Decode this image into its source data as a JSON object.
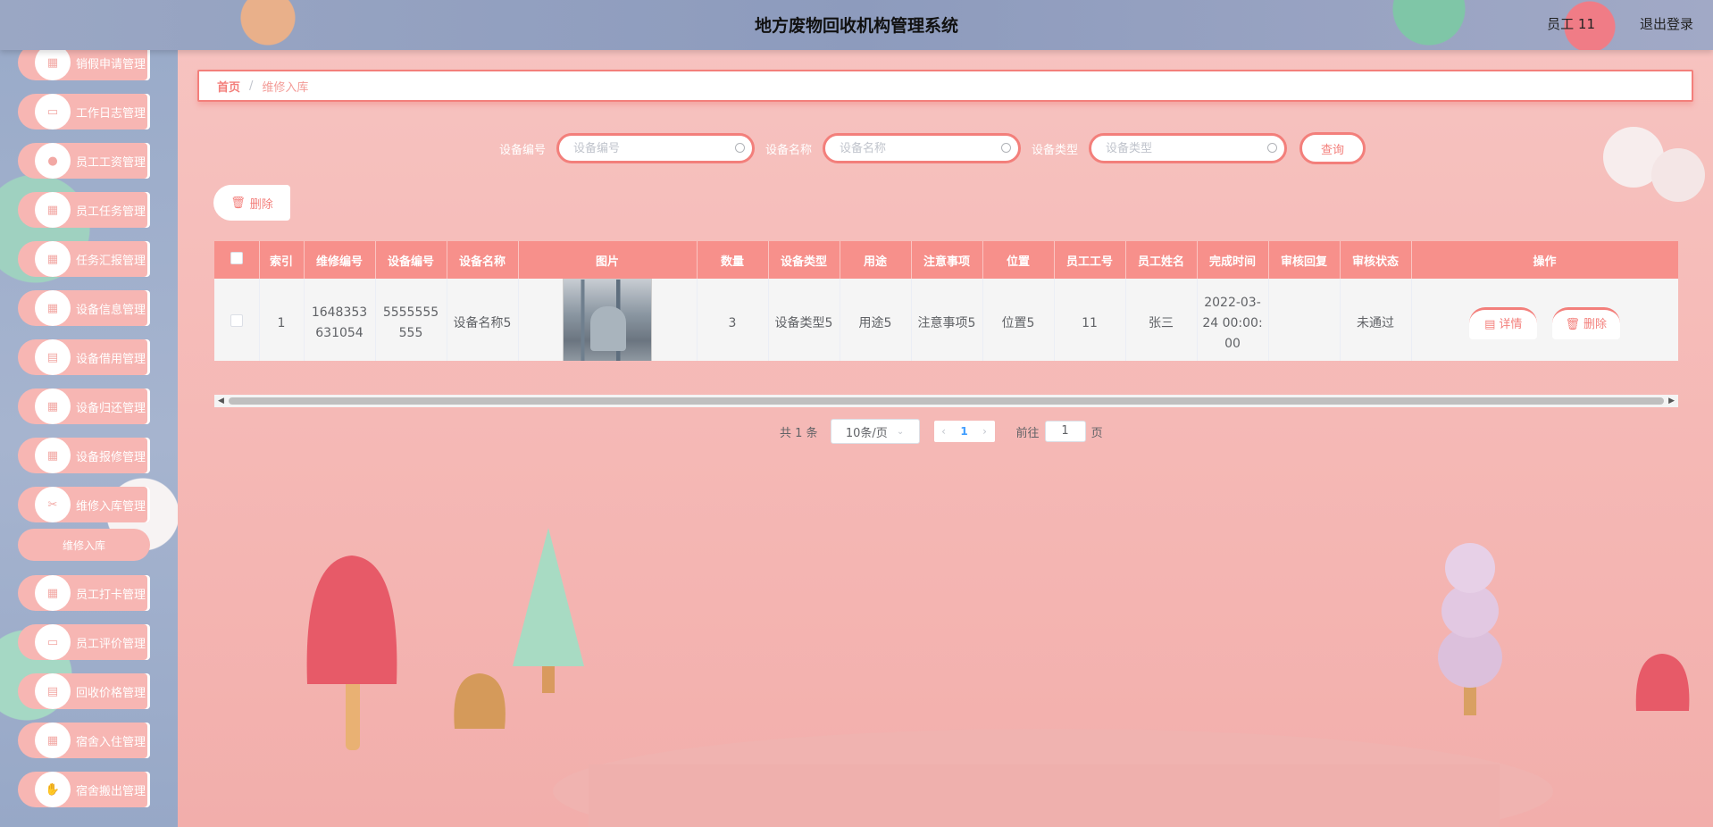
{
  "header": {
    "title": "地方废物回收机构管理系统",
    "user": "员工 11",
    "logout": "退出登录"
  },
  "sidebar": {
    "items": [
      {
        "label": "销假申请管理",
        "icon": "grid-icon",
        "glyph": "▦"
      },
      {
        "label": "工作日志管理",
        "icon": "monitor-icon",
        "glyph": "▭"
      },
      {
        "label": "员工工资管理",
        "icon": "user-icon",
        "glyph": "●"
      },
      {
        "label": "员工任务管理",
        "icon": "grid-icon",
        "glyph": "▦"
      },
      {
        "label": "任务汇报管理",
        "icon": "grid-icon",
        "glyph": "▦"
      },
      {
        "label": "设备信息管理",
        "icon": "grid-icon",
        "glyph": "▦"
      },
      {
        "label": "设备借用管理",
        "icon": "clipboard-icon",
        "glyph": "▤"
      },
      {
        "label": "设备归还管理",
        "icon": "grid-icon",
        "glyph": "▦"
      },
      {
        "label": "设备报修管理",
        "icon": "grid-icon",
        "glyph": "▦"
      },
      {
        "label": "维修入库管理",
        "icon": "ticket-icon",
        "glyph": "✂"
      }
    ],
    "submenu": "维修入库",
    "items_after": [
      {
        "label": "员工打卡管理",
        "icon": "grid-icon",
        "glyph": "▦"
      },
      {
        "label": "员工评价管理",
        "icon": "message-icon",
        "glyph": "▭"
      },
      {
        "label": "回收价格管理",
        "icon": "document-icon",
        "glyph": "▤"
      },
      {
        "label": "宿舍入住管理",
        "icon": "grid-icon",
        "glyph": "▦"
      },
      {
        "label": "宿舍搬出管理",
        "icon": "thumb-icon",
        "glyph": "✋"
      }
    ]
  },
  "breadcrumb": {
    "home": "首页",
    "separator": "/",
    "current": "维修入库"
  },
  "search": {
    "device_no_label": "设备编号",
    "device_no_placeholder": "设备编号",
    "device_name_label": "设备名称",
    "device_name_placeholder": "设备名称",
    "device_type_label": "设备类型",
    "device_type_placeholder": "设备类型",
    "query_button": "查询"
  },
  "toolbar": {
    "delete_button": "删除"
  },
  "table": {
    "columns": [
      "索引",
      "维修编号",
      "设备编号",
      "设备名称",
      "图片",
      "数量",
      "设备类型",
      "用途",
      "注意事项",
      "位置",
      "员工工号",
      "员工姓名",
      "完成时间",
      "审核回复",
      "审核状态",
      "操作"
    ],
    "rows": [
      {
        "index": "1",
        "repair_no": "1648353631054",
        "device_no": "5555555555",
        "device_name": "设备名称5",
        "quantity": "3",
        "device_type": "设备类型5",
        "purpose": "用途5",
        "notes": "注意事项5",
        "location": "位置5",
        "staff_no": "11",
        "staff_name": "张三",
        "finish_time": "2022-03-24 00:00:00",
        "review_reply": "",
        "review_status": "未通过",
        "detail_button": "详情",
        "delete_button": "删除"
      }
    ]
  },
  "pagination": {
    "total": "共 1 条",
    "page_size": "10条/页",
    "current_page": "1",
    "goto_label": "前往",
    "goto_value": "1",
    "page_suffix": "页"
  },
  "colors": {
    "accent": "#f37f7b",
    "header_row": "#f7908b",
    "sidebar_item": "#f7b6b3",
    "page_background": "#f5b8b5"
  }
}
